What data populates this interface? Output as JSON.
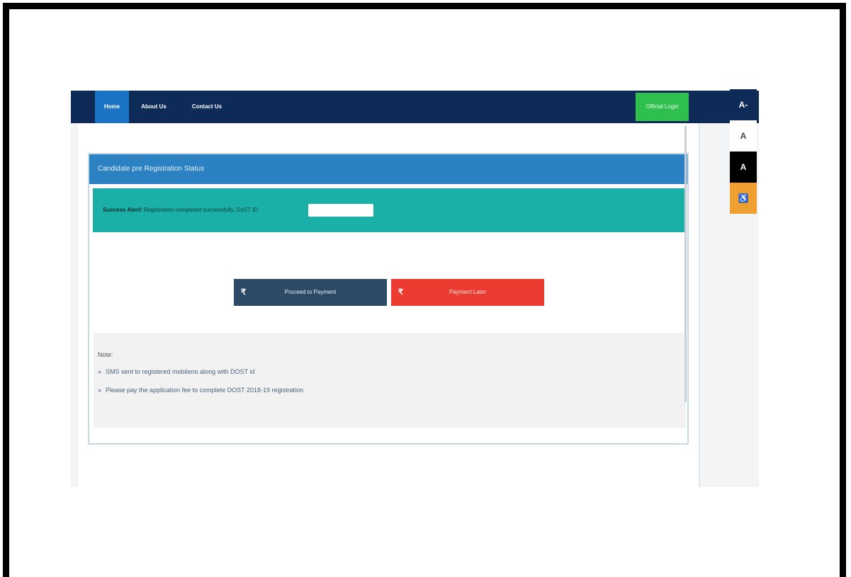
{
  "nav": {
    "items": [
      "Home",
      "About Us",
      "Contact Us"
    ],
    "official_login": "Official Login"
  },
  "status": {
    "heading": "Candidate pre Registration Status",
    "alert_bold": "Success Alert!",
    "alert_text": " Registration completed successfully. DoST ID"
  },
  "buttons": {
    "proceed_icon": "₹",
    "proceed_label": "Proceed to Payment",
    "later_icon": "₹",
    "later_label": "Payment Later"
  },
  "note": {
    "title": "Note:",
    "items": [
      "SMS sent to registered mobileno along with DOST id",
      "Please pay the application fee to complete DOST 2018-19 registration"
    ]
  },
  "accessibility": {
    "decrease": "A-",
    "normal": "A",
    "contrast": "A",
    "access_icon": "♿"
  },
  "colors": {
    "navbar": "#0e2b58",
    "home_active": "#1a73c4",
    "official_login": "#2fbf4e",
    "heading": "#2b81c1",
    "alert": "#1ab0a7",
    "proceed_button": "#2c4a66",
    "later_button": "#ec3c31",
    "accessibility_icon": "#f0a030"
  }
}
